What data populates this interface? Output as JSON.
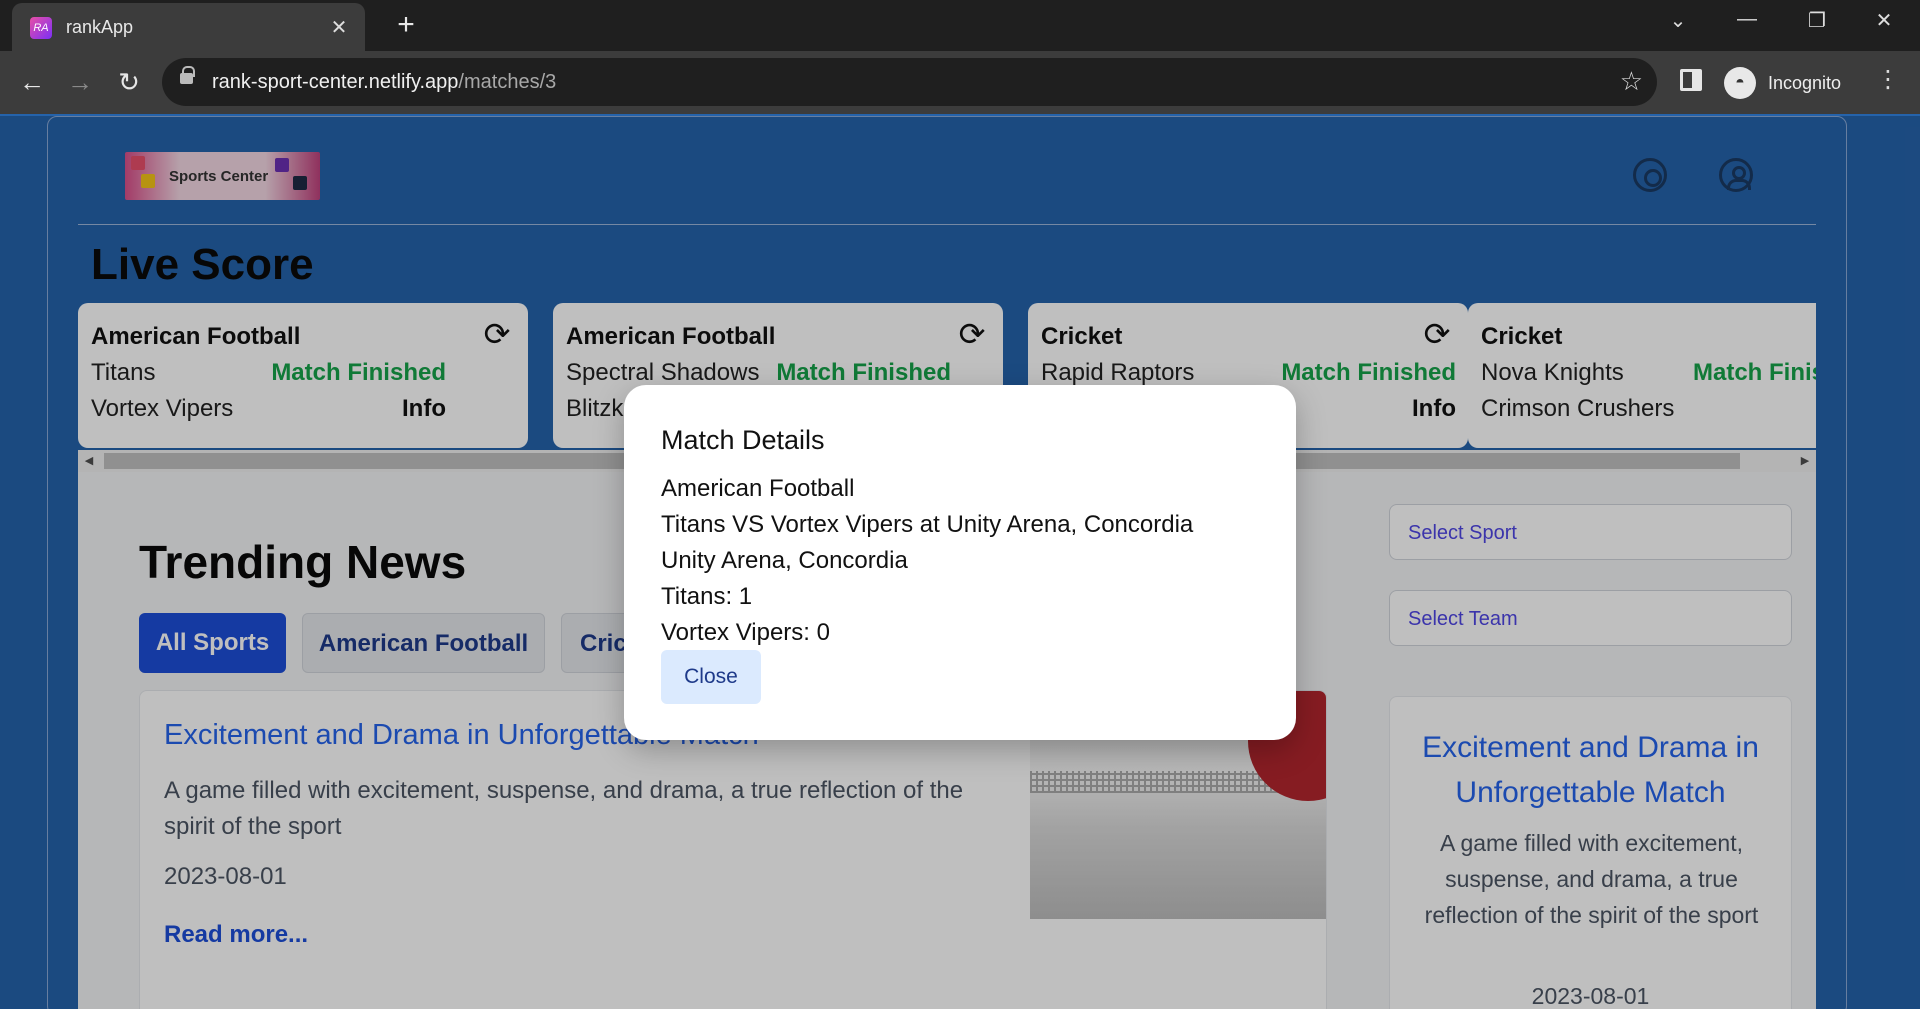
{
  "browser": {
    "tab_title": "rankApp",
    "url_host": "rank-sport-center.netlify.app",
    "url_path": "/matches/3",
    "profile_label": "Incognito"
  },
  "header": {
    "logo_text": "Sports Center"
  },
  "live_score": {
    "title": "Live Score",
    "cards": [
      {
        "sport": "American Football",
        "team1": "Titans",
        "team2": "Vortex Vipers",
        "status": "Match Finished",
        "info": "Info"
      },
      {
        "sport": "American Football",
        "team1": "Spectral Shadows",
        "team2": "Blitzk",
        "status": "Match Finished",
        "info": ""
      },
      {
        "sport": "Cricket",
        "team1": "Rapid Raptors",
        "team2": "",
        "status": "Match Finished",
        "info": "Info"
      },
      {
        "sport": "Cricket",
        "team1": "Nova Knights",
        "team2": "Crimson Crushers",
        "status": "Match Finis",
        "info": ""
      }
    ]
  },
  "trending": {
    "title": "Trending News",
    "tabs": [
      "All Sports",
      "American Football",
      "Cric"
    ],
    "article": {
      "title": "Excitement and Drama in Unforgettable Match",
      "summary": "A game filled with excitement, suspense, and drama, a true reflection of the spirit of the sport",
      "date": "2023-08-01",
      "read_more": "Read more..."
    }
  },
  "sidebar": {
    "select_sport": "Select Sport",
    "select_team": "Select Team",
    "article": {
      "title": "Excitement and Drama in Unforgettable Match",
      "summary": "A game filled with excitement, suspense, and drama, a true reflection of the spirit of the sport",
      "date": "2023-08-01"
    }
  },
  "modal": {
    "title": "Match Details",
    "sport": "American Football",
    "matchup": "Titans VS Vortex Vipers at Unity Arena, Concordia",
    "venue": "Unity Arena, Concordia",
    "score1": "Titans: 1",
    "score2": "Vortex Vipers: 0",
    "close_label": "Close"
  },
  "colors": {
    "page_bg": "#2563ab",
    "status_green": "#16a34a",
    "link_blue": "#2563eb",
    "active_tab": "#1d4ed8"
  }
}
